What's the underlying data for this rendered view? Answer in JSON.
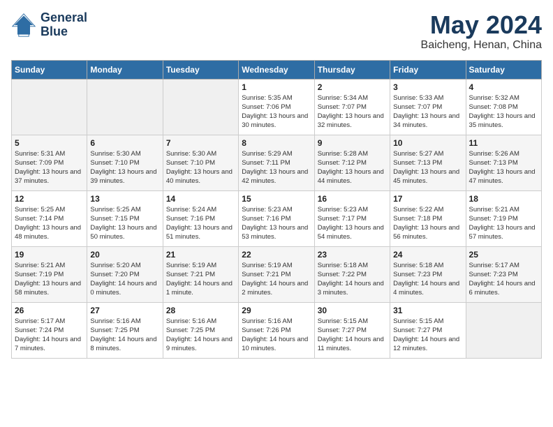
{
  "header": {
    "logo_line1": "General",
    "logo_line2": "Blue",
    "title": "May 2024",
    "subtitle": "Baicheng, Henan, China"
  },
  "days_of_week": [
    "Sunday",
    "Monday",
    "Tuesday",
    "Wednesday",
    "Thursday",
    "Friday",
    "Saturday"
  ],
  "weeks": [
    [
      {
        "day": "",
        "info": ""
      },
      {
        "day": "",
        "info": ""
      },
      {
        "day": "",
        "info": ""
      },
      {
        "day": "1",
        "info": "Sunrise: 5:35 AM\nSunset: 7:06 PM\nDaylight: 13 hours\nand 30 minutes."
      },
      {
        "day": "2",
        "info": "Sunrise: 5:34 AM\nSunset: 7:07 PM\nDaylight: 13 hours\nand 32 minutes."
      },
      {
        "day": "3",
        "info": "Sunrise: 5:33 AM\nSunset: 7:07 PM\nDaylight: 13 hours\nand 34 minutes."
      },
      {
        "day": "4",
        "info": "Sunrise: 5:32 AM\nSunset: 7:08 PM\nDaylight: 13 hours\nand 35 minutes."
      }
    ],
    [
      {
        "day": "5",
        "info": "Sunrise: 5:31 AM\nSunset: 7:09 PM\nDaylight: 13 hours\nand 37 minutes."
      },
      {
        "day": "6",
        "info": "Sunrise: 5:30 AM\nSunset: 7:10 PM\nDaylight: 13 hours\nand 39 minutes."
      },
      {
        "day": "7",
        "info": "Sunrise: 5:30 AM\nSunset: 7:10 PM\nDaylight: 13 hours\nand 40 minutes."
      },
      {
        "day": "8",
        "info": "Sunrise: 5:29 AM\nSunset: 7:11 PM\nDaylight: 13 hours\nand 42 minutes."
      },
      {
        "day": "9",
        "info": "Sunrise: 5:28 AM\nSunset: 7:12 PM\nDaylight: 13 hours\nand 44 minutes."
      },
      {
        "day": "10",
        "info": "Sunrise: 5:27 AM\nSunset: 7:13 PM\nDaylight: 13 hours\nand 45 minutes."
      },
      {
        "day": "11",
        "info": "Sunrise: 5:26 AM\nSunset: 7:13 PM\nDaylight: 13 hours\nand 47 minutes."
      }
    ],
    [
      {
        "day": "12",
        "info": "Sunrise: 5:25 AM\nSunset: 7:14 PM\nDaylight: 13 hours\nand 48 minutes."
      },
      {
        "day": "13",
        "info": "Sunrise: 5:25 AM\nSunset: 7:15 PM\nDaylight: 13 hours\nand 50 minutes."
      },
      {
        "day": "14",
        "info": "Sunrise: 5:24 AM\nSunset: 7:16 PM\nDaylight: 13 hours\nand 51 minutes."
      },
      {
        "day": "15",
        "info": "Sunrise: 5:23 AM\nSunset: 7:16 PM\nDaylight: 13 hours\nand 53 minutes."
      },
      {
        "day": "16",
        "info": "Sunrise: 5:23 AM\nSunset: 7:17 PM\nDaylight: 13 hours\nand 54 minutes."
      },
      {
        "day": "17",
        "info": "Sunrise: 5:22 AM\nSunset: 7:18 PM\nDaylight: 13 hours\nand 56 minutes."
      },
      {
        "day": "18",
        "info": "Sunrise: 5:21 AM\nSunset: 7:19 PM\nDaylight: 13 hours\nand 57 minutes."
      }
    ],
    [
      {
        "day": "19",
        "info": "Sunrise: 5:21 AM\nSunset: 7:19 PM\nDaylight: 13 hours\nand 58 minutes."
      },
      {
        "day": "20",
        "info": "Sunrise: 5:20 AM\nSunset: 7:20 PM\nDaylight: 14 hours\nand 0 minutes."
      },
      {
        "day": "21",
        "info": "Sunrise: 5:19 AM\nSunset: 7:21 PM\nDaylight: 14 hours\nand 1 minute."
      },
      {
        "day": "22",
        "info": "Sunrise: 5:19 AM\nSunset: 7:21 PM\nDaylight: 14 hours\nand 2 minutes."
      },
      {
        "day": "23",
        "info": "Sunrise: 5:18 AM\nSunset: 7:22 PM\nDaylight: 14 hours\nand 3 minutes."
      },
      {
        "day": "24",
        "info": "Sunrise: 5:18 AM\nSunset: 7:23 PM\nDaylight: 14 hours\nand 4 minutes."
      },
      {
        "day": "25",
        "info": "Sunrise: 5:17 AM\nSunset: 7:23 PM\nDaylight: 14 hours\nand 6 minutes."
      }
    ],
    [
      {
        "day": "26",
        "info": "Sunrise: 5:17 AM\nSunset: 7:24 PM\nDaylight: 14 hours\nand 7 minutes."
      },
      {
        "day": "27",
        "info": "Sunrise: 5:16 AM\nSunset: 7:25 PM\nDaylight: 14 hours\nand 8 minutes."
      },
      {
        "day": "28",
        "info": "Sunrise: 5:16 AM\nSunset: 7:25 PM\nDaylight: 14 hours\nand 9 minutes."
      },
      {
        "day": "29",
        "info": "Sunrise: 5:16 AM\nSunset: 7:26 PM\nDaylight: 14 hours\nand 10 minutes."
      },
      {
        "day": "30",
        "info": "Sunrise: 5:15 AM\nSunset: 7:27 PM\nDaylight: 14 hours\nand 11 minutes."
      },
      {
        "day": "31",
        "info": "Sunrise: 5:15 AM\nSunset: 7:27 PM\nDaylight: 14 hours\nand 12 minutes."
      },
      {
        "day": "",
        "info": ""
      }
    ]
  ]
}
